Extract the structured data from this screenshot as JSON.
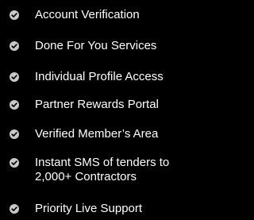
{
  "features": {
    "icon": "check-circle-icon",
    "icon_color": "#c8c8c8",
    "text_color": "#ffffff",
    "background": "#000000",
    "items": [
      {
        "label": "Account Verification"
      },
      {
        "label": "Done For You Services"
      },
      {
        "label": "Individual Profile Access"
      },
      {
        "label": "Partner Rewards Portal"
      },
      {
        "label": "Verified Member’s Area"
      },
      {
        "label": "Instant SMS of tenders to 2,000+ Contractors"
      },
      {
        "label": "Priority Live Support"
      }
    ]
  }
}
